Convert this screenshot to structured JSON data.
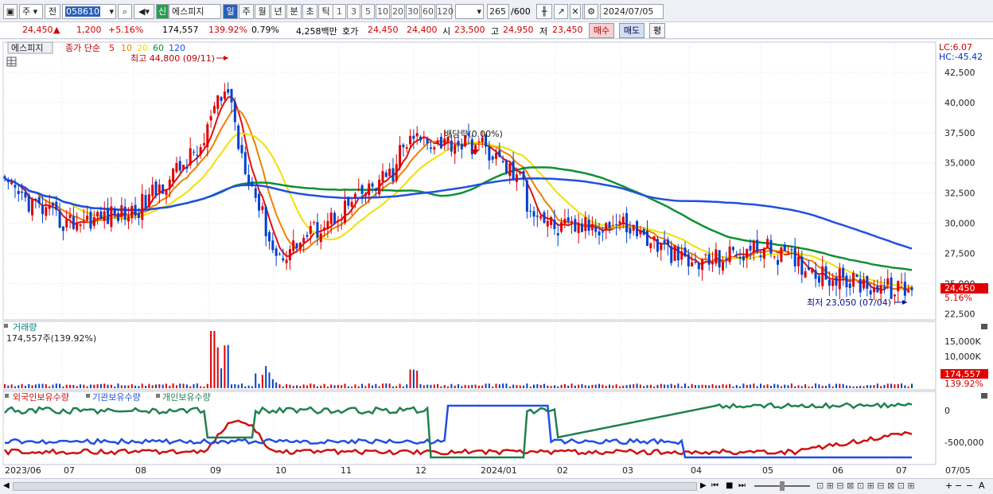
{
  "toolbar": {
    "market": "주",
    "mode": "전",
    "code": "058610",
    "credit_badge": "신",
    "stock_name": "에스피지",
    "periods": [
      "일",
      "주",
      "월",
      "년",
      "분",
      "초",
      "틱"
    ],
    "selected_period": "일",
    "intervals": [
      "1",
      "3",
      "5",
      "10",
      "20",
      "30",
      "60",
      "120"
    ],
    "count": "265",
    "count_total": "/600",
    "date": "2024/07/05"
  },
  "quote": {
    "price": "24,450",
    "change_arrow": "▲",
    "change": "1,200",
    "change_pct": "+5.16%",
    "volume": "174,557",
    "volume_ratio": "139.92%",
    "turnover": "0.79%",
    "amount": "4,258백만",
    "bid_label": "호가",
    "ask_price": "24,450",
    "bid_price": "24,400",
    "open_label": "시",
    "open": "23,500",
    "high_label": "고",
    "high": "24,950",
    "low_label": "저",
    "low": "23,450",
    "buy_button": "매수",
    "sell_button": "매도",
    "eval_button": "평"
  },
  "price_panel": {
    "name_tag": "에스피지",
    "ma_label": "종가 단순",
    "ma_periods": [
      "5",
      "10",
      "20",
      "60",
      "120"
    ],
    "ma_colors": [
      "#e01010",
      "#f08000",
      "#f0e000",
      "#109030",
      "#2050e0"
    ],
    "high_note": "최고 44,800 (09/11)",
    "low_note": "최저 23,050 (07/04)",
    "dividend_note": "배당락(0.00%)",
    "lc": "LC:6.07",
    "hc": "HC:-45.42",
    "price_ticks": [
      "42,500",
      "40,000",
      "37,500",
      "35,000",
      "32,500",
      "30,000",
      "27,500",
      "25,000",
      "22,500"
    ],
    "last_price_tag": "24,450",
    "last_pct_tag": "5.16%"
  },
  "volume_panel": {
    "title": "거래량",
    "info": "174,557주(139.92%)",
    "ticks": [
      "15,000K",
      "10,000K"
    ],
    "last_tag": "174,557",
    "last_pct": "139.92%"
  },
  "holdings_panel": {
    "series_labels": [
      "외국인보유수량",
      "기관보유수량",
      "개인보유수량"
    ],
    "series_colors": [
      "#d01010",
      "#2050e0",
      "#208050"
    ],
    "ticks": [
      "0",
      "-500,000"
    ]
  },
  "x_axis": {
    "labels": [
      "2023/06",
      "07",
      "08",
      "09",
      "10",
      "11",
      "12",
      "2024/01",
      "02",
      "03",
      "04",
      "05",
      "06",
      "07",
      "07/05"
    ]
  },
  "chart_data": {
    "type": "candlestick",
    "title": "에스피지",
    "ylim": [
      22000,
      45000
    ],
    "y_ticks": [
      22500,
      25000,
      27500,
      30000,
      32500,
      35000,
      37500,
      40000,
      42500
    ],
    "monthly_close_approx": [
      {
        "month": "2023/06",
        "close": 33000
      },
      {
        "month": "07",
        "close": 30000
      },
      {
        "month": "08",
        "close": 31000
      },
      {
        "month": "09",
        "close": 37000
      },
      {
        "month": "10",
        "close": 27000
      },
      {
        "month": "11",
        "close": 31000
      },
      {
        "month": "12",
        "close": 35500
      },
      {
        "month": "2024/01",
        "close": 35000
      },
      {
        "month": "02",
        "close": 29500
      },
      {
        "month": "03",
        "close": 30000
      },
      {
        "month": "04",
        "close": 26500
      },
      {
        "month": "05",
        "close": 28000
      },
      {
        "month": "06",
        "close": 25500
      },
      {
        "month": "07",
        "close": 24450
      }
    ],
    "high": {
      "value": 44800,
      "date": "09/11"
    },
    "low": {
      "value": 23050,
      "date": "07/04"
    },
    "last": 24450
  }
}
